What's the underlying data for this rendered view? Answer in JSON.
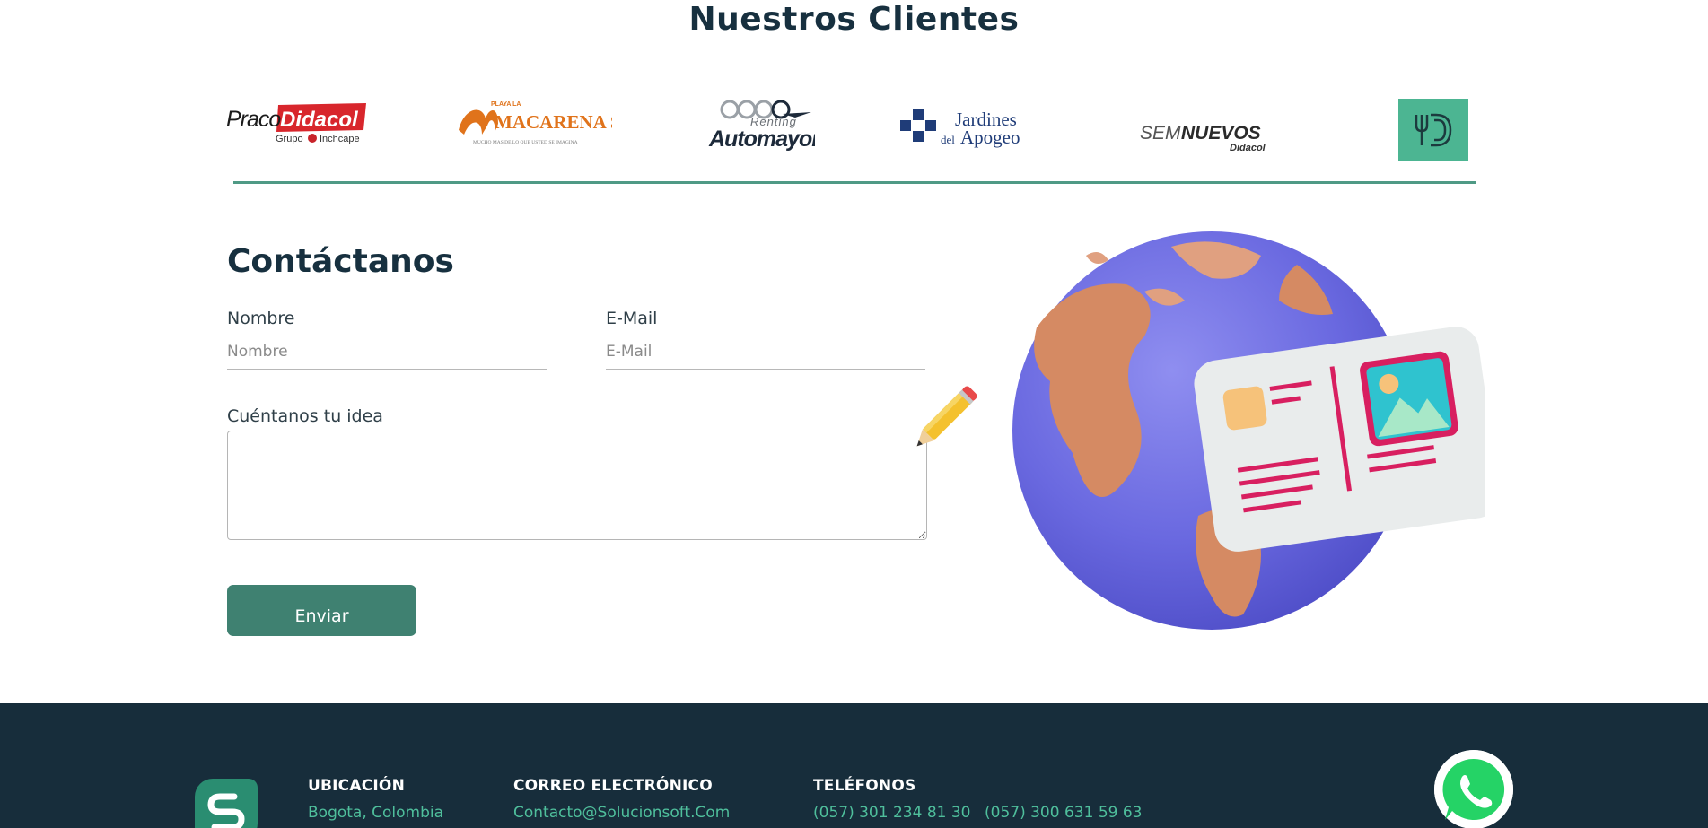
{
  "clients": {
    "title": "Nuestros Clientes",
    "logos": [
      {
        "name": "praco-didacol",
        "text_main": "Praco",
        "text_brand": "Didacol",
        "text_sub": "Grupo",
        "text_sub2": "Inchcape"
      },
      {
        "name": "playa-la-macarena",
        "text_top": "PLAYA LA",
        "text_main": "MACARENA S.A.",
        "text_sub": "MUCHO MAS DE LO QUE USTED SE IMAGINA"
      },
      {
        "name": "automayor",
        "text_top": "Renting",
        "text_main": "Automayor"
      },
      {
        "name": "jardines-del-apogeo",
        "text_main": "Jardines",
        "text_sub_a": "del",
        "text_sub_b": "Apogeo"
      },
      {
        "name": "seminuevos-didacol",
        "text_a": "SEMI",
        "text_b": "NUEVOS",
        "text_sub": "Didacol"
      },
      {
        "name": "restaurant-logo"
      }
    ]
  },
  "contact": {
    "title": "Contáctanos",
    "name_label": "Nombre",
    "name_placeholder": "Nombre",
    "email_label": "E-Mail",
    "email_placeholder": "E-Mail",
    "idea_label": "Cuéntanos tu idea",
    "send_label": "Enviar"
  },
  "footer": {
    "location_title": "UBICACIÓN",
    "location_value": "Bogota, Colombia",
    "email_title": "CORREO ELECTRÓNICO",
    "email_value": "Contacto@Solucionsoft.Com",
    "phones_title": "TELÉFONOS",
    "phone_1": "(057) 301 234 81 30",
    "phone_2": "(057) 300 631 59 63"
  },
  "colors": {
    "accent": "#3f8171",
    "divider": "#4f9a85",
    "footer_bg": "#172d3b",
    "footer_link": "#4fbf9c",
    "heading": "#17303f"
  },
  "icons": [
    "solucionsoft-logo-icon",
    "whatsapp-icon",
    "pencil-icon",
    "globe-postcard-illustration"
  ]
}
